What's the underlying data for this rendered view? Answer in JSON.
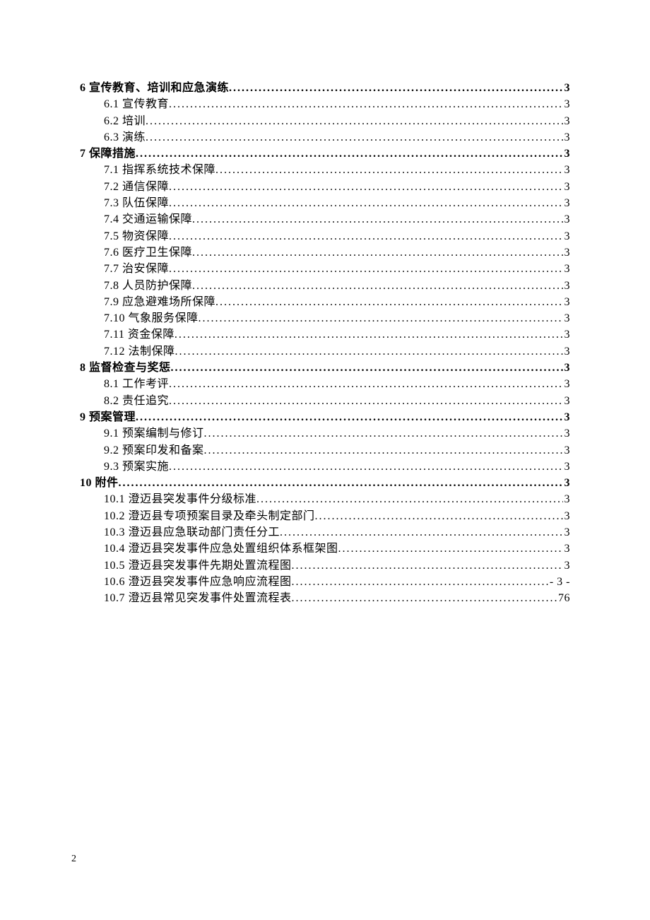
{
  "page_number": "2",
  "toc": [
    {
      "level": 1,
      "num": "6",
      "title": " 宣传教育、培训和应急演练",
      "page": "3"
    },
    {
      "level": 2,
      "num": "6.1",
      "title": " 宣传教育",
      "page": "3"
    },
    {
      "level": 2,
      "num": "6.2",
      "title": " 培训",
      "page": "3"
    },
    {
      "level": 2,
      "num": "6.3",
      "title": " 演练",
      "page": "3"
    },
    {
      "level": 1,
      "num": "7",
      "title": " 保障措施",
      "page": "3"
    },
    {
      "level": 2,
      "num": "7.1",
      "title": " 指挥系统技术保障",
      "page": "3"
    },
    {
      "level": 2,
      "num": "7.2",
      "title": " 通信保障",
      "page": "3"
    },
    {
      "level": 2,
      "num": "7.3",
      "title": " 队伍保障",
      "page": "3"
    },
    {
      "level": 2,
      "num": "7.4",
      "title": " 交通运输保障",
      "page": "3"
    },
    {
      "level": 2,
      "num": "7.5",
      "title": " 物资保障",
      "page": "3"
    },
    {
      "level": 2,
      "num": "7.6",
      "title": " 医疗卫生保障",
      "page": "3"
    },
    {
      "level": 2,
      "num": "7.7",
      "title": " 治安保障",
      "page": "3"
    },
    {
      "level": 2,
      "num": "7.8",
      "title": " 人员防护保障",
      "page": "3"
    },
    {
      "level": 2,
      "num": "7.9",
      "title": " 应急避难场所保障",
      "page": "3"
    },
    {
      "level": 2,
      "num": "7.10",
      "title": " 气象服务保障",
      "page": "3"
    },
    {
      "level": 2,
      "num": "7.11",
      "title": " 资金保障",
      "page": "3"
    },
    {
      "level": 2,
      "num": "7.12",
      "title": " 法制保障",
      "page": "3"
    },
    {
      "level": 1,
      "num": "8",
      "title": " 监督检查与奖惩",
      "page": "3"
    },
    {
      "level": 2,
      "num": "8.1",
      "title": " 工作考评",
      "page": "3"
    },
    {
      "level": 2,
      "num": "8.2",
      "title": " 责任追究",
      "page": "3"
    },
    {
      "level": 1,
      "num": "9",
      "title": " 预案管理",
      "page": "3"
    },
    {
      "level": 2,
      "num": "9.1",
      "title": " 预案编制与修订",
      "page": "3"
    },
    {
      "level": 2,
      "num": "9.2",
      "title": " 预案印发和备案",
      "page": "3"
    },
    {
      "level": 2,
      "num": "9.3",
      "title": " 预案实施",
      "page": "3"
    },
    {
      "level": 1,
      "num": "10",
      "title": " 附件",
      "page": "3"
    },
    {
      "level": 2,
      "num": "10.1",
      "title": " 澄迈县突发事件分级标准",
      "page": "3"
    },
    {
      "level": 2,
      "num": "10.2",
      "title": " 澄迈县专项预案目录及牵头制定部门",
      "page": "3"
    },
    {
      "level": 2,
      "num": "10.3",
      "title": " 澄迈县应急联动部门责任分工",
      "page": "3"
    },
    {
      "level": 2,
      "num": "10.4",
      "title": " 澄迈县突发事件应急处置组织体系框架图",
      "page": "3"
    },
    {
      "level": 2,
      "num": "10.5",
      "title": " 澄迈县突发事件先期处置流程图",
      "page": "3"
    },
    {
      "level": 2,
      "num": "10.6",
      "title": " 澄迈县突发事件应急响应流程图",
      "page": "- 3 -"
    },
    {
      "level": 2,
      "num": "10.7",
      "title": " 澄迈县常见突发事件处置流程表",
      "page": "76"
    }
  ]
}
